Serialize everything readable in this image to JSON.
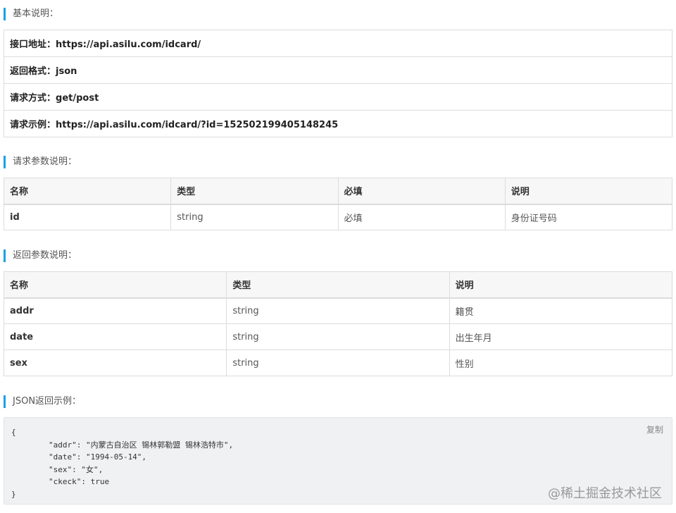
{
  "basic": {
    "title": "基本说明：",
    "rows": [
      {
        "label": "接口地址：",
        "value": "https://api.asilu.com/idcard/"
      },
      {
        "label": "返回格式：",
        "value": "json"
      },
      {
        "label": "请求方式：",
        "value": "get/post"
      },
      {
        "label": "请求示例：",
        "value": "https://api.asilu.com/idcard/?id=152502199405148245"
      }
    ]
  },
  "request_params": {
    "title": "请求参数说明：",
    "headers": [
      "名称",
      "类型",
      "必填",
      "说明"
    ],
    "rows": [
      [
        "id",
        "string",
        "必填",
        "身份证号码"
      ]
    ]
  },
  "response_params": {
    "title": "返回参数说明：",
    "headers": [
      "名称",
      "类型",
      "说明"
    ],
    "rows": [
      [
        "addr",
        "string",
        "籍贯"
      ],
      [
        "date",
        "string",
        "出生年月"
      ],
      [
        "sex",
        "string",
        "性别"
      ]
    ]
  },
  "json_example": {
    "title": "JSON返回示例：",
    "copy_label": "复制",
    "lines": [
      "{",
      "        \"addr\": \"内蒙古自治区 锡林郭勒盟 锡林浩特市\",",
      "        \"date\": \"1994-05-14\",",
      "        \"sex\": \"女\",",
      "        \"ckeck\": true",
      "}"
    ]
  },
  "watermark": "@稀土掘金技术社区"
}
